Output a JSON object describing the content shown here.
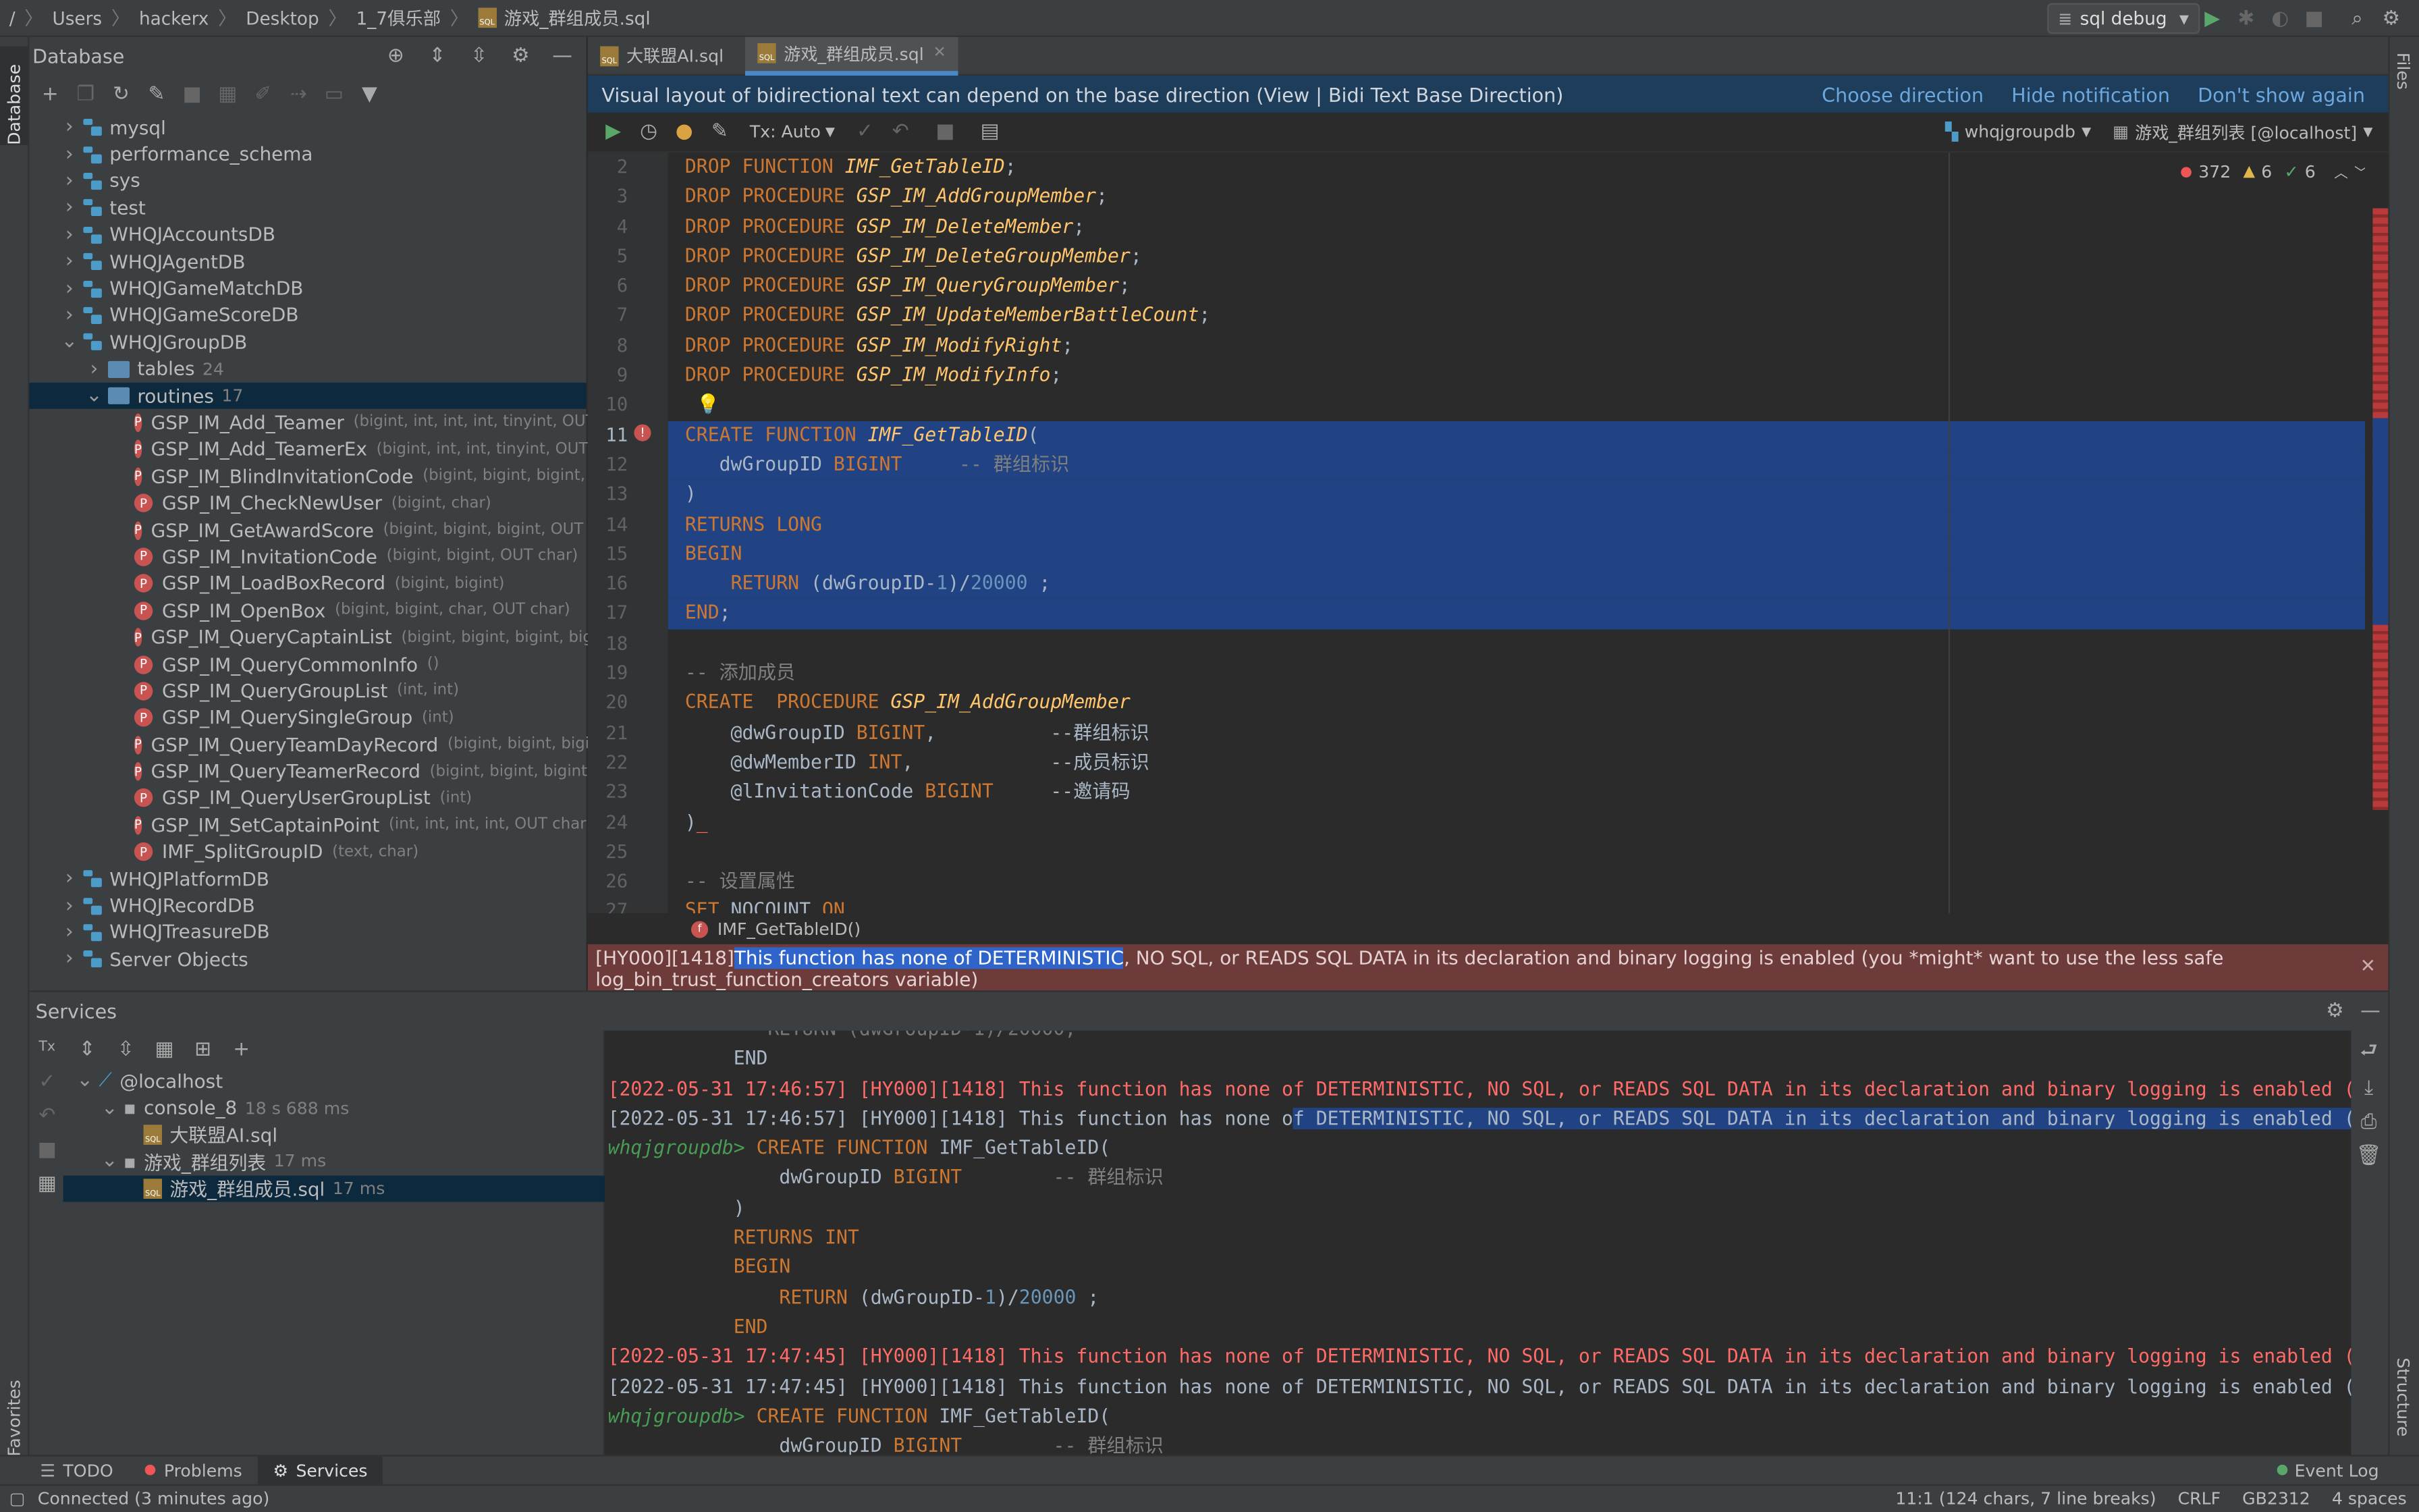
{
  "topbar": {
    "path": [
      "/",
      "Users",
      "hackerx",
      "Desktop",
      "1_7俱乐部",
      "游戏_群组成员.sql"
    ],
    "run_config": "sql debug"
  },
  "strips": {
    "database": "Database",
    "files": "Files",
    "favorites": "Favorites",
    "structure": "Structure"
  },
  "db_panel": {
    "title": "Database",
    "tree": [
      {
        "label": "mysql",
        "kind": "db",
        "indent": 1,
        "arrow": "closed"
      },
      {
        "label": "performance_schema",
        "kind": "db",
        "indent": 1,
        "arrow": "closed"
      },
      {
        "label": "sys",
        "kind": "db",
        "indent": 1,
        "arrow": "closed"
      },
      {
        "label": "test",
        "kind": "db",
        "indent": 1,
        "arrow": "closed"
      },
      {
        "label": "WHQJAccountsDB",
        "kind": "db",
        "indent": 1,
        "arrow": "closed"
      },
      {
        "label": "WHQJAgentDB",
        "kind": "db",
        "indent": 1,
        "arrow": "closed"
      },
      {
        "label": "WHQJGameMatchDB",
        "kind": "db",
        "indent": 1,
        "arrow": "closed"
      },
      {
        "label": "WHQJGameScoreDB",
        "kind": "db",
        "indent": 1,
        "arrow": "closed"
      },
      {
        "label": "WHQJGroupDB",
        "kind": "db",
        "indent": 1,
        "arrow": "open"
      },
      {
        "label": "tables",
        "count": "24",
        "kind": "folder",
        "indent": 2,
        "arrow": "closed"
      },
      {
        "label": "routines",
        "count": "17",
        "kind": "folder",
        "indent": 2,
        "arrow": "open",
        "selected": true
      },
      {
        "label": "GSP_IM_Add_Teamer",
        "sig": "(bigint, int, int, int, tinyint, OUT char",
        "kind": "proc",
        "indent": 3
      },
      {
        "label": "GSP_IM_Add_TeamerEx",
        "sig": "(bigint, int, int, tinyint, OUT int)",
        "kind": "proc",
        "indent": 3
      },
      {
        "label": "GSP_IM_BlindInvitationCode",
        "sig": "(bigint, bigint, bigint, OUT",
        "kind": "proc",
        "indent": 3
      },
      {
        "label": "GSP_IM_CheckNewUser",
        "sig": "(bigint, char)",
        "kind": "proc",
        "indent": 3
      },
      {
        "label": "GSP_IM_GetAwardScore",
        "sig": "(bigint, bigint, bigint, OUT char",
        "kind": "proc",
        "indent": 3
      },
      {
        "label": "GSP_IM_InvitationCode",
        "sig": "(bigint, bigint, OUT char)",
        "kind": "proc",
        "indent": 3
      },
      {
        "label": "GSP_IM_LoadBoxRecord",
        "sig": "(bigint, bigint)",
        "kind": "proc",
        "indent": 3
      },
      {
        "label": "GSP_IM_OpenBox",
        "sig": "(bigint, bigint, char, OUT char)",
        "kind": "proc",
        "indent": 3
      },
      {
        "label": "GSP_IM_QueryCaptainList",
        "sig": "(bigint, bigint, bigint, bigint, c",
        "kind": "proc",
        "indent": 3
      },
      {
        "label": "GSP_IM_QueryCommonInfo",
        "sig": "()",
        "kind": "proc",
        "indent": 3
      },
      {
        "label": "GSP_IM_QueryGroupList",
        "sig": "(int, int)",
        "kind": "proc",
        "indent": 3
      },
      {
        "label": "GSP_IM_QuerySingleGroup",
        "sig": "(int)",
        "kind": "proc",
        "indent": 3
      },
      {
        "label": "GSP_IM_QueryTeamDayRecord",
        "sig": "(bigint, bigint, bigint, O",
        "kind": "proc",
        "indent": 3
      },
      {
        "label": "GSP_IM_QueryTeamerRecord",
        "sig": "(bigint, bigint, bigint, bigi",
        "kind": "proc",
        "indent": 3
      },
      {
        "label": "GSP_IM_QueryUserGroupList",
        "sig": "(int)",
        "kind": "proc",
        "indent": 3
      },
      {
        "label": "GSP_IM_SetCaptainPoint",
        "sig": "(int, int, int, int, OUT char)",
        "kind": "proc",
        "indent": 3
      },
      {
        "label": "IMF_SplitGroupID",
        "sig": "(text, char)",
        "kind": "proc",
        "indent": 3
      },
      {
        "label": "WHQJPlatformDB",
        "kind": "db",
        "indent": 1,
        "arrow": "closed"
      },
      {
        "label": "WHQJRecordDB",
        "kind": "db",
        "indent": 1,
        "arrow": "closed"
      },
      {
        "label": "WHQJTreasureDB",
        "kind": "db",
        "indent": 1,
        "arrow": "closed"
      },
      {
        "label": "Server Objects",
        "kind": "db",
        "indent": 1,
        "arrow": "closed"
      }
    ]
  },
  "editor": {
    "tabs": [
      {
        "label": "大联盟AI.sql",
        "active": false
      },
      {
        "label": "游戏_群组成员.sql",
        "active": true
      }
    ],
    "notice": {
      "text": "Visual layout of bidirectional text can depend on the base direction (View | Bidi Text Base Direction)",
      "links": [
        "Choose direction",
        "Hide notification",
        "Don't show again"
      ]
    },
    "tx_mode": "Tx: Auto",
    "schema": "whqjgroupdb",
    "session": "游戏_群组列表 [@localhost]",
    "inspections": {
      "errors": "372",
      "warnings": "6",
      "weak": "6"
    },
    "breadcrumb": "IMF_GetTableID()",
    "error_message": {
      "code": "[HY000][1418]",
      "highlighted": "This function has none of DETERMINISTIC",
      "rest": ", NO SQL, or READS SQL DATA in its declaration and binary logging is enabled (you *might* want to use the less safe log_bin_trust_function_creators variable)"
    }
  },
  "services": {
    "title": "Services",
    "tree": [
      {
        "label": "@localhost",
        "indent": 0
      },
      {
        "label": "console_8",
        "time": "18 s 688 ms",
        "indent": 1
      },
      {
        "label": "大联盟AI.sql",
        "indent": 2
      },
      {
        "label": "游戏_群组列表",
        "time": "17 ms",
        "indent": 1
      },
      {
        "label": "游戏_群组成员.sql",
        "time": "17 ms",
        "indent": 2,
        "selected": true
      }
    ]
  },
  "bottom_tabs": [
    "TODO",
    "Problems",
    "Services"
  ],
  "event_log": "Event Log",
  "status": {
    "connection": "Connected (3 minutes ago)",
    "position": "11:1 (124 chars, 7 line breaks)",
    "line_sep": "CRLF",
    "encoding": "GB2312",
    "indent": "4 spaces"
  },
  "colors": {
    "accent": "#4a88c7",
    "selection": "#214283",
    "error_bar": "#6e3b3b",
    "keyword": "#cc7832"
  }
}
